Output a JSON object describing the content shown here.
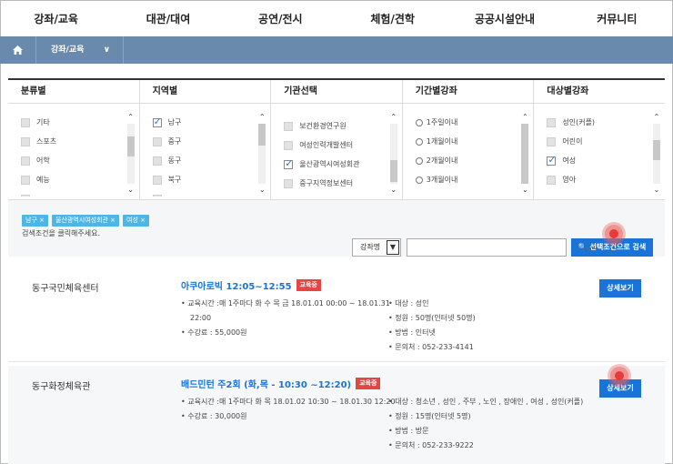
{
  "nav": [
    "강좌/교육",
    "대관/대여",
    "공연/전시",
    "체험/견학",
    "공공시설안내",
    "커뮤니티"
  ],
  "breadcrumb": {
    "current": "강좌/교육"
  },
  "filters": [
    {
      "title": "분류별",
      "type": "checkbox",
      "options": [
        {
          "label": "기타",
          "checked": false
        },
        {
          "label": "스포츠",
          "checked": false
        },
        {
          "label": "어학",
          "checked": false
        },
        {
          "label": "예능",
          "checked": false
        },
        {
          "label": "",
          "checked": false
        }
      ]
    },
    {
      "title": "지역별",
      "type": "checkbox",
      "options": [
        {
          "label": "남구",
          "checked": true
        },
        {
          "label": "중구",
          "checked": false
        },
        {
          "label": "동구",
          "checked": false
        },
        {
          "label": "북구",
          "checked": false
        },
        {
          "label": "",
          "checked": false
        }
      ]
    },
    {
      "title": "기관선택",
      "type": "checkbox",
      "options": [
        {
          "label": "보건환경연구원",
          "checked": false
        },
        {
          "label": "여성인력개발센터",
          "checked": false
        },
        {
          "label": "울산광역시여성회관",
          "checked": true
        },
        {
          "label": "중구지역정보센터",
          "checked": false
        }
      ]
    },
    {
      "title": "기간별강좌",
      "type": "radio",
      "options": [
        {
          "label": "1주일이내"
        },
        {
          "label": "1개월이내"
        },
        {
          "label": "2개월이내"
        },
        {
          "label": "3개월이내"
        }
      ]
    },
    {
      "title": "대상별강좌",
      "type": "checkbox",
      "options": [
        {
          "label": "성인(커플)",
          "checked": false
        },
        {
          "label": "어린이",
          "checked": false
        },
        {
          "label": "여성",
          "checked": true
        },
        {
          "label": "영아",
          "checked": false
        }
      ]
    }
  ],
  "selected_tags": [
    "남구 ×",
    "울산광역시여성회관 ×",
    "여성 ×"
  ],
  "hint": "검색조건을 클릭해주세요.",
  "search": {
    "select_value": "강좌명",
    "select_arrow": "▼",
    "button_label": "🔍 선택조건으로 검색"
  },
  "results": [
    {
      "place": "동구국민체육센터",
      "title": "아쿠아로빅 12:05~12:55",
      "badge": "교육중",
      "left_lines": [
        "교육시간 :매 1주마다 화 수 목 금 18.01.01 00:00 ~ 18.01.31",
        "22:00",
        "수강료 : 55,000원"
      ],
      "right_lines": [
        "대상 : 성인",
        "정원 : 50명(인터넷 50명)",
        "방법 : 인터넷",
        "문의처 : 052-233-4141"
      ],
      "button": "상세보기"
    },
    {
      "place": "동구화정체육관",
      "title": "배드민턴 주2회 (화,목 - 10:30 ~12:20)",
      "badge": "교육중",
      "left_lines": [
        "교육시간 :매 1주마다 화 목 18.01.02 10:30 ~ 18.01.30 12:20",
        "수강료 : 30,000원"
      ],
      "right_lines": [
        "대상 : 청소년 , 성인 , 주부 , 노인 , 장애인 , 여성 , 성인(커플)",
        "정원 : 15명(인터넷 5명)",
        "방법 : 방문",
        "문의처 : 052-233-9222"
      ],
      "button": "상세보기"
    }
  ]
}
